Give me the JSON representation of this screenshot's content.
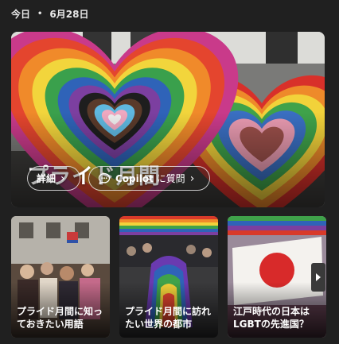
{
  "header": {
    "today": "今日",
    "separator": "•",
    "date": "6月28日"
  },
  "hero": {
    "title": "プライド月間",
    "details_label": "詳細",
    "copilot_name": "Copilot",
    "copilot_suffix": " に質問",
    "chevron": "›"
  },
  "cards": [
    {
      "title": "プライド月間に知っておきたい用語"
    },
    {
      "title": "プライド月間に訪れたい世界の都市"
    },
    {
      "title": "江戸時代の日本はLGBTの先進国？"
    }
  ],
  "icons": {
    "details_chevron": "chevron-right-icon",
    "copilot": "chat-bubble-icon",
    "copilot_chevron": "chevron-right-icon",
    "carousel_next": "caret-right-icon"
  }
}
